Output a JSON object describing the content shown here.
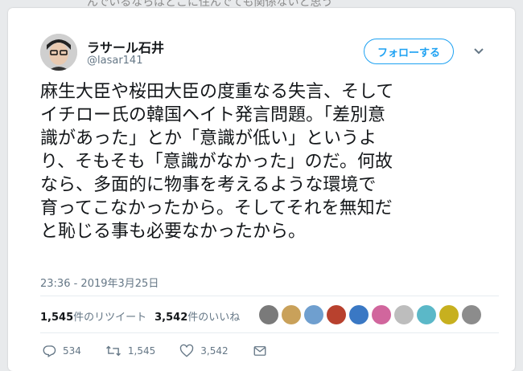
{
  "background_text": "んでいるならばどこに住んでても関係ないと思う",
  "user": {
    "name": "ラサール石井",
    "handle": "@lasar141"
  },
  "follow_button": "フォローする",
  "tweet_lines": [
    "麻生大臣や桜田大臣の度重なる失言、そして",
    "イチロー氏の韓国ヘイト発言問題。「差別意",
    "識があった」とか「意識が低い」というよ",
    "り、そもそも「意識がなかった」のだ。何故",
    "なら、多面的に物事を考えるような環境で",
    "育ってこなかったから。そしてそれを無知だ",
    "と恥じる事も必要なかったから。"
  ],
  "timestamp": "23:36 - 2019年3月25日",
  "stats": {
    "retweets": {
      "count": "1,545",
      "label": "件のリツイート"
    },
    "likes": {
      "count": "3,542",
      "label": "件のいいね"
    }
  },
  "actions": {
    "replies": "534",
    "retweets": "1,545",
    "likes": "3,542"
  },
  "colors": {
    "accent": "#1da1f2",
    "text": "#14171a",
    "muted": "#657786"
  },
  "likers_colors": [
    "#7a7a7a",
    "#c9a15a",
    "#6f9fcf",
    "#b8412e",
    "#3a78c4",
    "#d1669d",
    "#bdbdbd",
    "#5bb8c8",
    "#c7b01f",
    "#8c8c8c"
  ]
}
